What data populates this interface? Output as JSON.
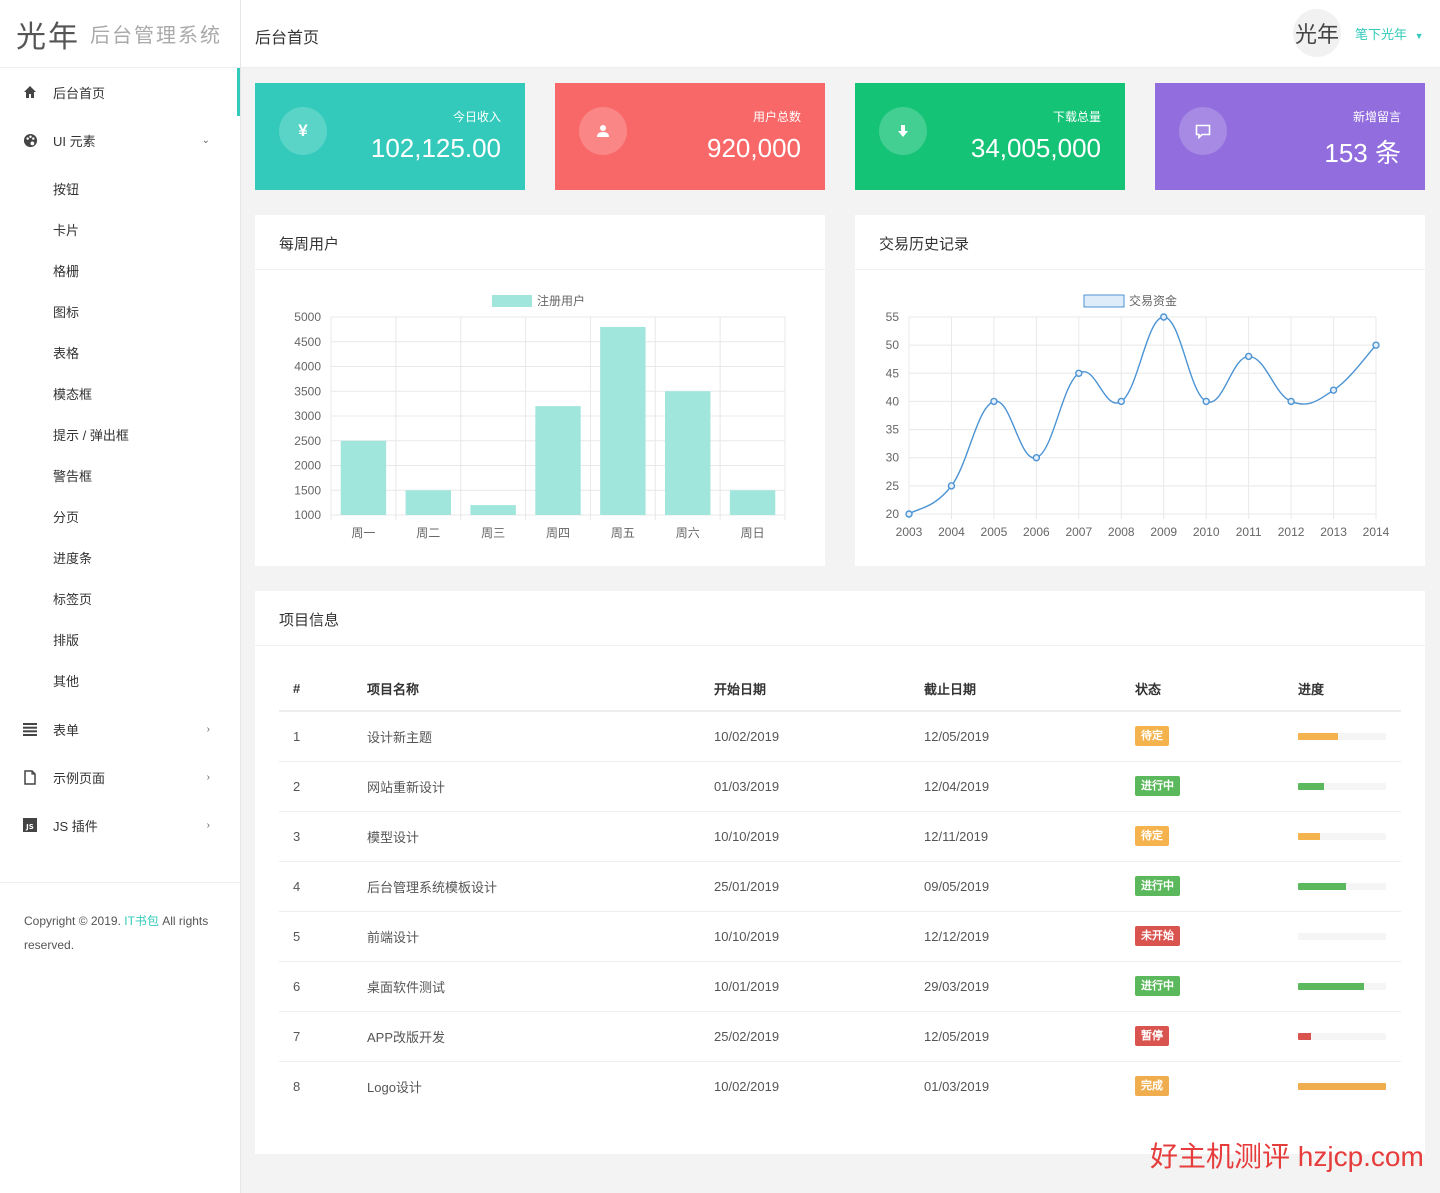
{
  "brand": {
    "mark": "光年",
    "name": "后台管理系统"
  },
  "sidebar": {
    "items": [
      {
        "label": "后台首页",
        "icon": "home-icon"
      },
      {
        "label": "UI 元素",
        "icon": "palette-icon"
      },
      {
        "label": "表单",
        "icon": "list-icon"
      },
      {
        "label": "示例页面",
        "icon": "file-icon"
      },
      {
        "label": "JS 插件",
        "icon": "js-icon"
      }
    ],
    "ui_sub": [
      "按钮",
      "卡片",
      "格栅",
      "图标",
      "表格",
      "模态框",
      "提示 / 弹出框",
      "警告框",
      "分页",
      "进度条",
      "标签页",
      "排版",
      "其他"
    ],
    "footer": {
      "pre": "Copyright © 2019. ",
      "link": "IT书包",
      "post": " All rights reserved."
    }
  },
  "header": {
    "title": "后台首页",
    "avatar_text": "光年",
    "user": "笔下光年"
  },
  "stats": [
    {
      "label": "今日收入",
      "value": "102,125.00",
      "icon": "yen-icon",
      "glyph": "¥",
      "color": "#33cabb"
    },
    {
      "label": "用户总数",
      "value": "920,000",
      "icon": "user-icon",
      "glyph": "●",
      "color": "#f96868"
    },
    {
      "label": "下载总量",
      "value": "34,005,000",
      "icon": "download-icon",
      "glyph": "⬇",
      "color": "#15c377"
    },
    {
      "label": "新增留言",
      "value": "153 条",
      "icon": "comment-icon",
      "glyph": "▭",
      "color": "#926dde"
    }
  ],
  "weekly": {
    "title": "每周用户"
  },
  "history": {
    "title": "交易历史记录"
  },
  "chart_data": [
    {
      "type": "bar",
      "categories": [
        "周一",
        "周二",
        "周三",
        "周四",
        "周五",
        "周六",
        "周日"
      ],
      "series": [
        {
          "name": "注册用户",
          "values": [
            2500,
            1500,
            1200,
            3200,
            4800,
            3500,
            1500
          ]
        }
      ],
      "ylim": [
        1000,
        5000
      ],
      "yticks": [
        5000,
        4500,
        4000,
        3500,
        3000,
        2500,
        2000,
        1500,
        1000
      ],
      "color": "#a0e6dd",
      "grid": true,
      "legend": "top"
    },
    {
      "type": "line",
      "x": [
        "2003",
        "2004",
        "2005",
        "2006",
        "2007",
        "2008",
        "2009",
        "2010",
        "2011",
        "2012",
        "2013",
        "2014"
      ],
      "series": [
        {
          "name": "交易资金",
          "values": [
            20,
            25,
            40,
            30,
            45,
            40,
            55,
            40,
            48,
            40,
            42,
            50
          ]
        }
      ],
      "ylim": [
        20,
        55
      ],
      "yticks": [
        55,
        50,
        45,
        40,
        35,
        30,
        25,
        20
      ],
      "color": "#4c93d3",
      "grid": true,
      "legend": "top"
    }
  ],
  "projects": {
    "title": "项目信息",
    "columns": [
      "#",
      "项目名称",
      "开始日期",
      "截止日期",
      "状态",
      "进度"
    ],
    "rows": [
      {
        "no": "1",
        "name": "设计新主题",
        "start": "10/02/2019",
        "end": "12/05/2019",
        "status": "待定",
        "color": "#f5b34d",
        "progress": 0.45
      },
      {
        "no": "2",
        "name": "网站重新设计",
        "start": "01/03/2019",
        "end": "12/04/2019",
        "status": "进行中",
        "color": "#5cb85c",
        "progress": 0.3
      },
      {
        "no": "3",
        "name": "模型设计",
        "start": "10/10/2019",
        "end": "12/11/2019",
        "status": "待定",
        "color": "#f5b34d",
        "progress": 0.25
      },
      {
        "no": "4",
        "name": "后台管理系统模板设计",
        "start": "25/01/2019",
        "end": "09/05/2019",
        "status": "进行中",
        "color": "#5cb85c",
        "progress": 0.55
      },
      {
        "no": "5",
        "name": "前端设计",
        "start": "10/10/2019",
        "end": "12/12/2019",
        "status": "未开始",
        "color": "#d9534f",
        "progress": 0
      },
      {
        "no": "6",
        "name": "桌面软件测试",
        "start": "10/01/2019",
        "end": "29/03/2019",
        "status": "进行中",
        "color": "#5cb85c",
        "progress": 0.75
      },
      {
        "no": "7",
        "name": "APP改版开发",
        "start": "25/02/2019",
        "end": "12/05/2019",
        "status": "暂停",
        "color": "#d9534f",
        "progress": 0.15
      },
      {
        "no": "8",
        "name": "Logo设计",
        "start": "10/02/2019",
        "end": "01/03/2019",
        "status": "完成",
        "color": "#f0ad4e",
        "progress": 1.0
      }
    ]
  },
  "watermark": "好主机测评 hzjcp.com"
}
